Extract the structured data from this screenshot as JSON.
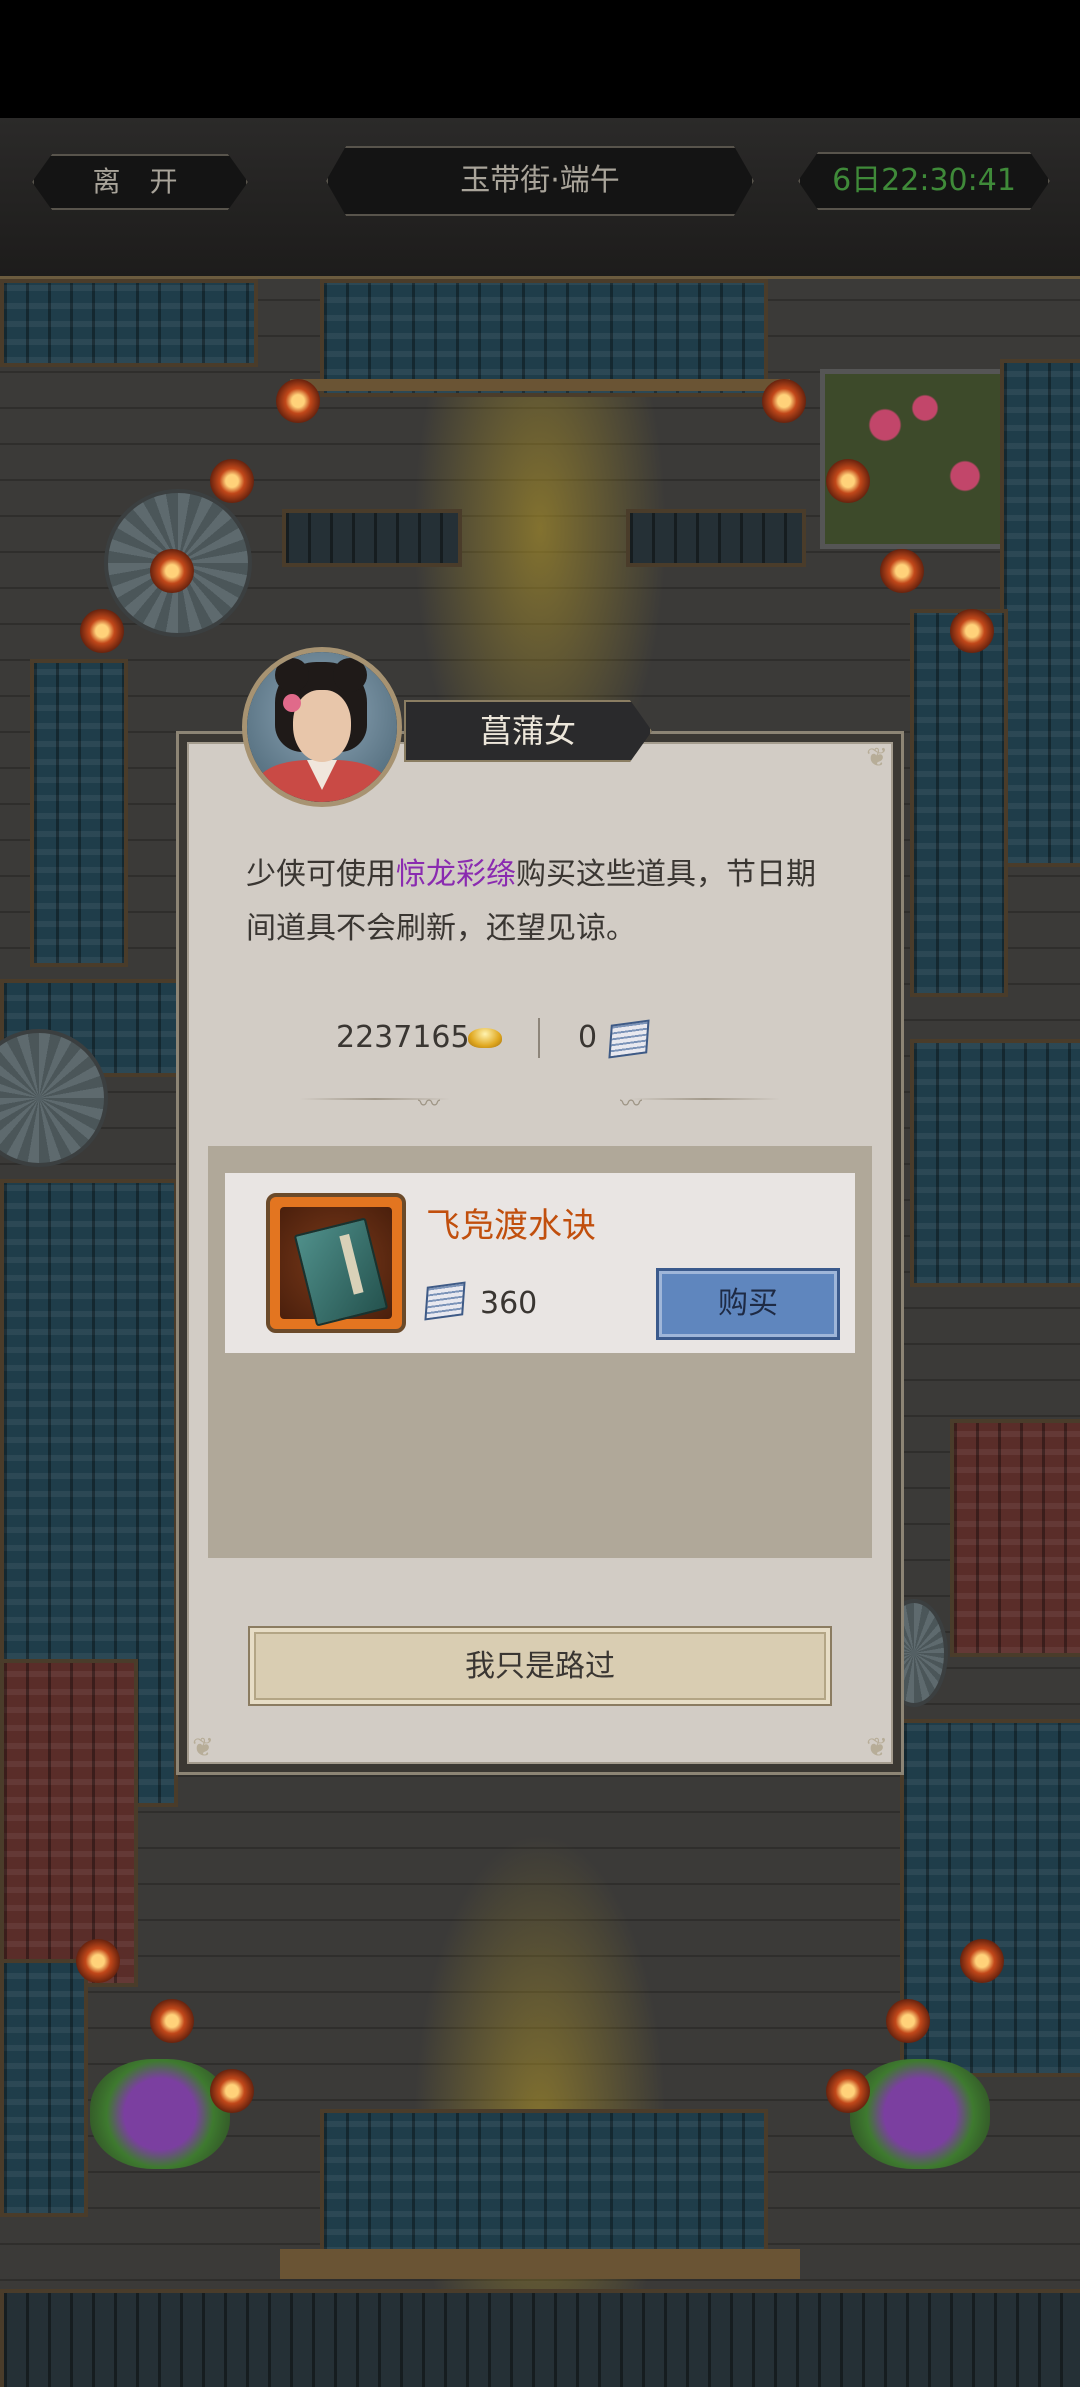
{
  "header": {
    "leave_label": "离 开",
    "location": "玉带街·端午",
    "countdown": "6日22:30:41"
  },
  "npc": {
    "name": "菖蒲女"
  },
  "message": {
    "before": "少侠可使用",
    "highlight": "惊龙彩绦",
    "after": "购买这些道具，节日期间道具不会刷新，还望见谅。"
  },
  "currency": {
    "silver_amount": "2237165",
    "silver_icon": "gold-ingot-icon",
    "token_amount": "0",
    "token_icon": "silk-ribbon-book-icon"
  },
  "shop": {
    "items": [
      {
        "name": "飞凫渡水诀",
        "icon": "manual-book-icon",
        "price": "360",
        "price_icon": "silk-ribbon-book-icon",
        "buy_label": "购买"
      }
    ]
  },
  "footer": {
    "pass_label": "我只是路过"
  },
  "colors": {
    "highlight": "#8a2bb0",
    "item_name": "#c14f0d",
    "countdown": "#3f8a39",
    "buy_button": "#5f86be"
  }
}
